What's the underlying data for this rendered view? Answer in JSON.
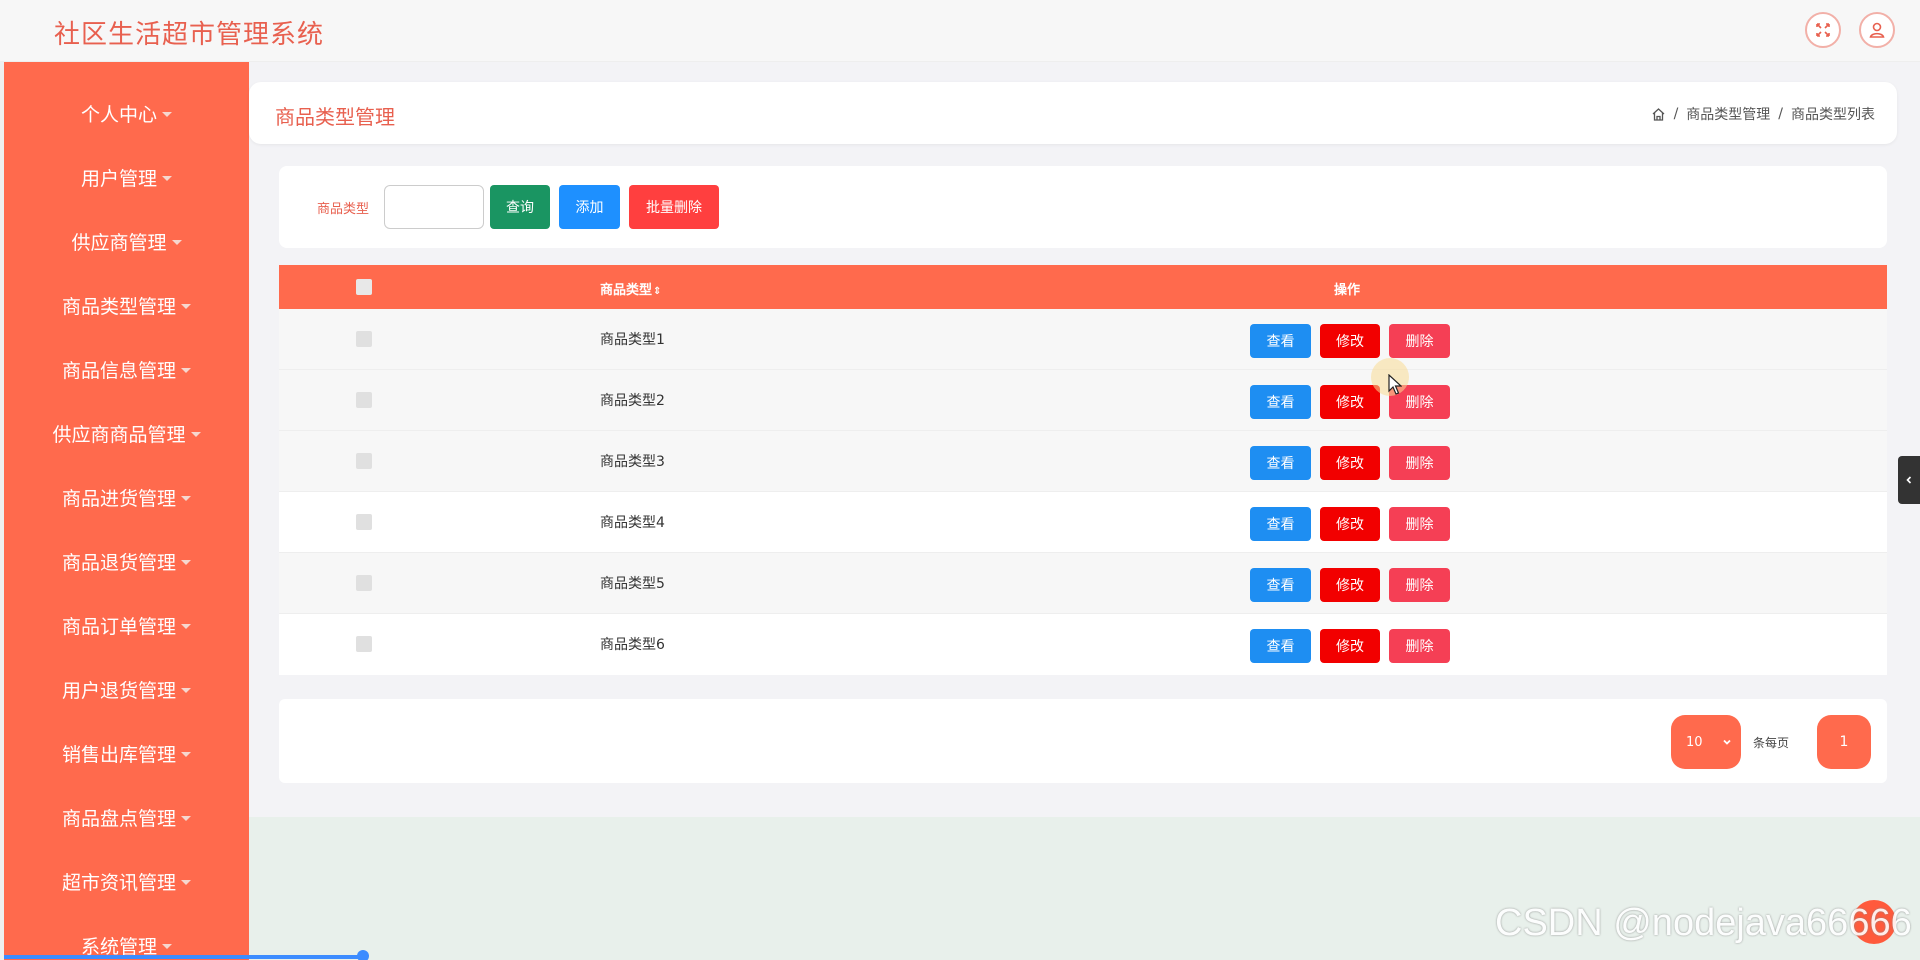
{
  "app": {
    "title": "社区生活超市管理系统"
  },
  "header_icons": [
    "fullscreen-icon",
    "user-icon"
  ],
  "sidebar": {
    "items": [
      {
        "label": "个人中心"
      },
      {
        "label": "用户管理"
      },
      {
        "label": "供应商管理"
      },
      {
        "label": "商品类型管理"
      },
      {
        "label": "商品信息管理"
      },
      {
        "label": "供应商商品管理"
      },
      {
        "label": "商品进货管理"
      },
      {
        "label": "商品退货管理"
      },
      {
        "label": "商品订单管理"
      },
      {
        "label": "用户退货管理"
      },
      {
        "label": "销售出库管理"
      },
      {
        "label": "商品盘点管理"
      },
      {
        "label": "超市资讯管理"
      },
      {
        "label": "系统管理"
      }
    ]
  },
  "page": {
    "title": "商品类型管理",
    "breadcrumb": [
      "商品类型管理",
      "商品类型列表"
    ],
    "breadcrumb_sep": "/"
  },
  "search": {
    "label": "商品类型",
    "value": "",
    "query_button": "查询",
    "add_button": "添加",
    "batch_delete_button": "批量删除"
  },
  "table": {
    "columns": {
      "type": "商品类型",
      "sort_icon": "⇕",
      "actions": "操作"
    },
    "rows": [
      {
        "name": "商品类型1"
      },
      {
        "name": "商品类型2"
      },
      {
        "name": "商品类型3"
      },
      {
        "name": "商品类型4"
      },
      {
        "name": "商品类型5"
      },
      {
        "name": "商品类型6"
      }
    ],
    "row_actions": {
      "view": "查看",
      "edit": "修改",
      "delete": "删除"
    }
  },
  "pagination": {
    "page_size": "10",
    "per_page_label": "条每页",
    "current_page": "1"
  },
  "watermark": "CSDN @nodejava66666",
  "colors": {
    "primary": "#ff6a4d",
    "title": "#e8604f",
    "query": "#1a9562",
    "add": "#1e90ff",
    "batch_delete": "#ff3f3f",
    "view": "#1e8ef2",
    "edit": "#f20000",
    "delete": "#f53f55"
  }
}
